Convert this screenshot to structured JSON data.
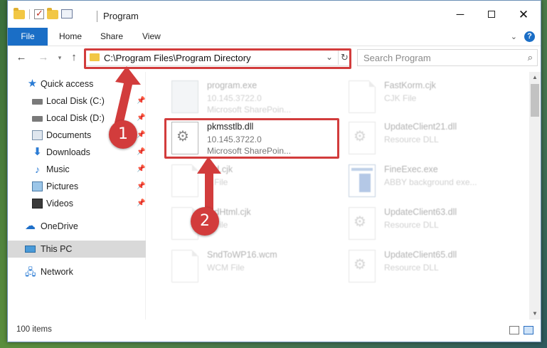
{
  "window": {
    "title": "Program",
    "min_glyph": "─",
    "close_glyph": "✕"
  },
  "ribbon": {
    "tabs": [
      "File",
      "Home",
      "Share",
      "View"
    ],
    "help_glyph": "?",
    "collapse_glyph": "⌄"
  },
  "navbar": {
    "back_glyph": "←",
    "forward_glyph": "→",
    "recent_glyph": "▾",
    "up_glyph": "↑",
    "address": "C:\\Program Files\\Program Directory",
    "address_dropdown_glyph": "⌄",
    "refresh_glyph": "↻",
    "search_placeholder": "Search Program",
    "search_glyph": "⌕"
  },
  "sidebar": {
    "pin_glyph": "📌",
    "items": [
      {
        "label": "Quick access",
        "icon": "star-icon",
        "pinned": false
      },
      {
        "label": "Local Disk (C:)",
        "icon": "disk-icon",
        "pinned": true
      },
      {
        "label": "Local Disk (D:)",
        "icon": "disk-icon",
        "pinned": true
      },
      {
        "label": "Documents",
        "icon": "documents-icon",
        "pinned": true
      },
      {
        "label": "Downloads",
        "icon": "download-icon",
        "pinned": true
      },
      {
        "label": "Music",
        "icon": "music-icon",
        "pinned": true
      },
      {
        "label": "Pictures",
        "icon": "pictures-icon",
        "pinned": true
      },
      {
        "label": "Videos",
        "icon": "videos-icon",
        "pinned": true
      },
      {
        "label": "OneDrive",
        "icon": "cloud-icon",
        "pinned": false
      },
      {
        "label": "This PC",
        "icon": "pc-icon",
        "pinned": false,
        "selected": true
      },
      {
        "label": "Network",
        "icon": "network-icon",
        "pinned": false
      }
    ]
  },
  "files": [
    {
      "name": "program.exe",
      "line2": "10.145.3722.0",
      "line3": "Microsoft SharePoin...",
      "icon": "exe-icon",
      "faded": true
    },
    {
      "name": "FastKorm.cjk",
      "line2": "CJK File",
      "line3": "",
      "icon": "document-icon",
      "faded": true
    },
    {
      "name": "pkmsstlb.dll",
      "line2": "10.145.3722.0",
      "line3": "Microsoft SharePoin...",
      "icon": "dll-gear-icon",
      "faded": false
    },
    {
      "name": "UpdateClient21.dll",
      "line2": "Resource DLL",
      "line3": "",
      "icon": "dll-gear-icon",
      "faded": true
    },
    {
      "name": "...d.cjk",
      "line2": "...File",
      "line3": "",
      "icon": "document-icon",
      "faded": true
    },
    {
      "name": "FineExec.exe",
      "line2": "ABBY background exe...",
      "line3": "",
      "icon": "app-icon",
      "faded": true
    },
    {
      "name": "...dHtml.cjk",
      "line2": "...File",
      "line3": "",
      "icon": "document-icon",
      "faded": true
    },
    {
      "name": "UpdateClient63.dll",
      "line2": "Resource DLL",
      "line3": "",
      "icon": "dll-gear-icon",
      "faded": true
    },
    {
      "name": "SndToWP16.wcm",
      "line2": "WCM File",
      "line3": "",
      "icon": "document-icon",
      "faded": true
    },
    {
      "name": "UpdateClient65.dll",
      "line2": "Resource DLL",
      "line3": "",
      "icon": "dll-gear-icon",
      "faded": true
    }
  ],
  "scrollbar": {
    "up_glyph": "▲",
    "down_glyph": "▼"
  },
  "status": {
    "item_count": "100 items"
  },
  "annotations": [
    {
      "label": "1",
      "color": "#d23c3c"
    },
    {
      "label": "2",
      "color": "#d23c3c"
    }
  ],
  "colors": {
    "accent": "#1a6ec6",
    "annotation": "#d23c3c"
  }
}
